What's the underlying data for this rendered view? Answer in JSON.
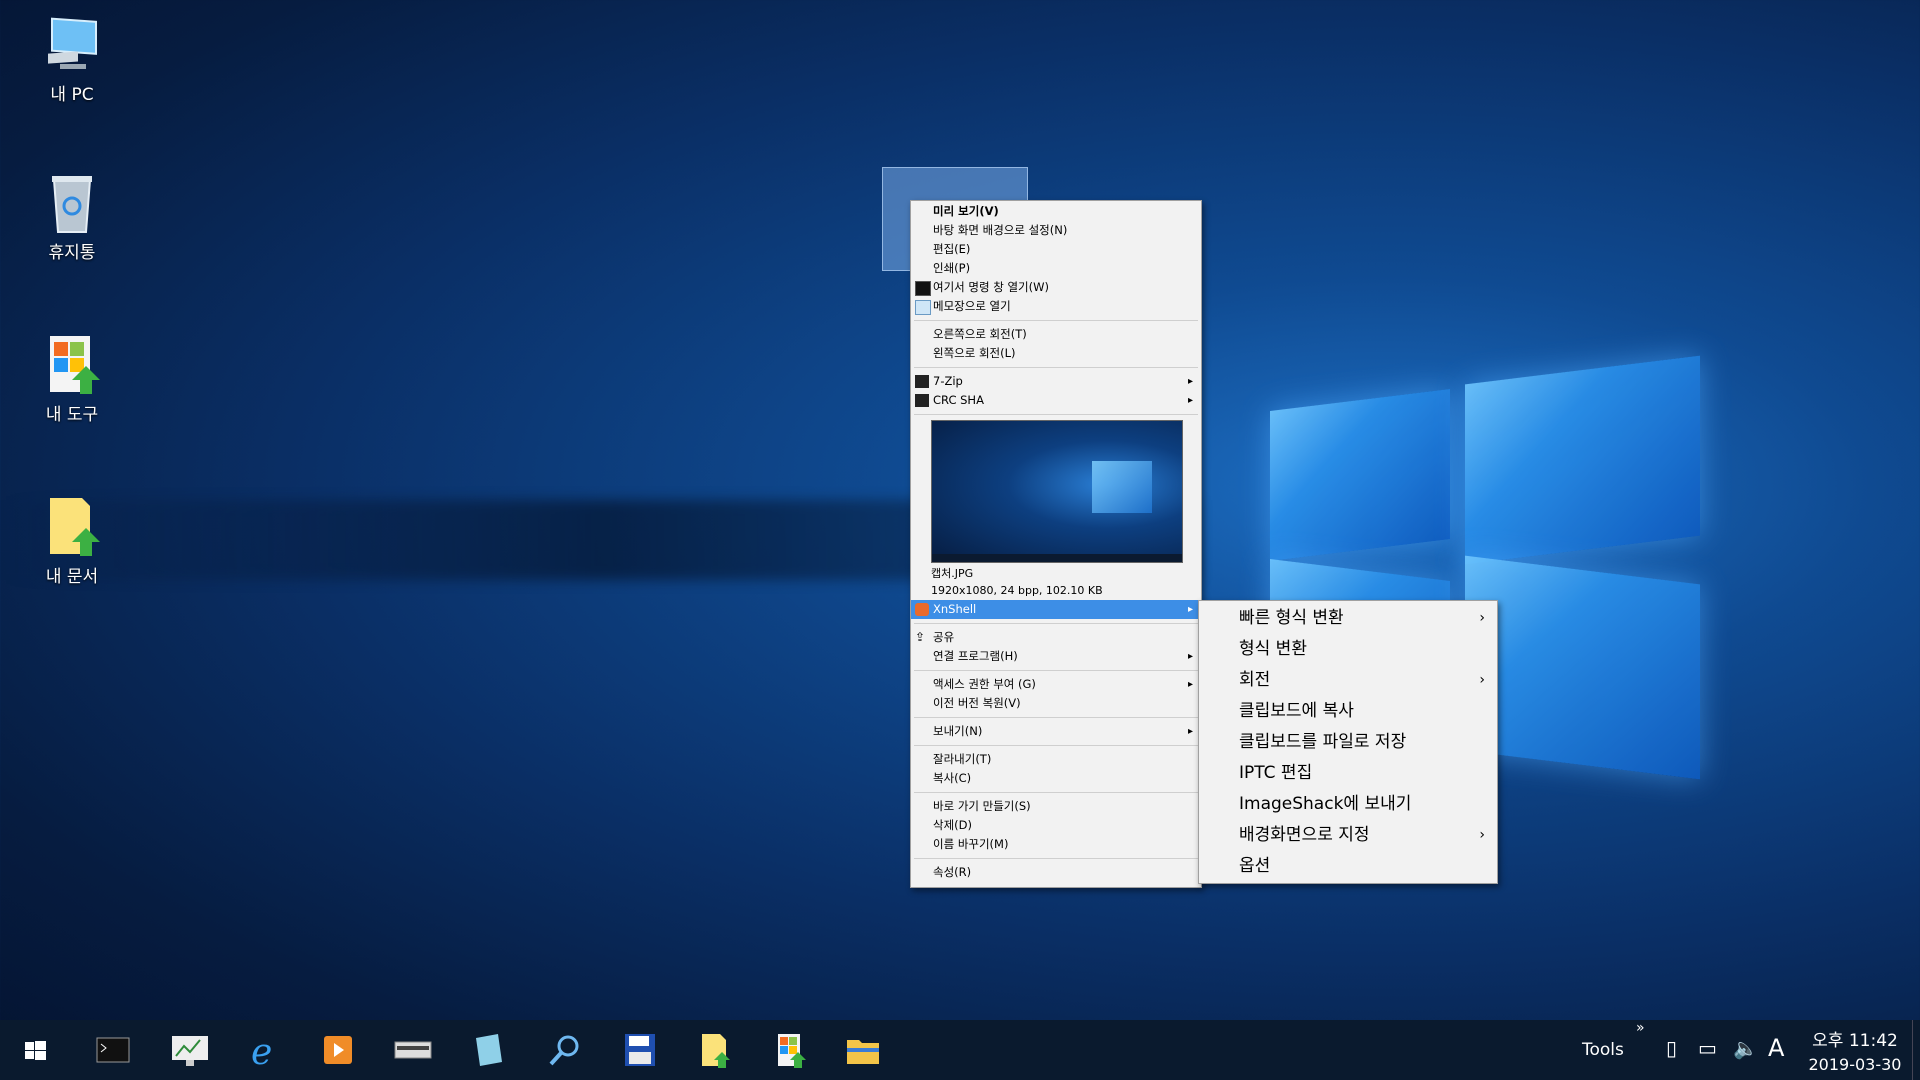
{
  "desktop": {
    "icons": [
      {
        "label": "내 PC",
        "icon": "pc-monitor-icon"
      },
      {
        "label": "휴지통",
        "icon": "recycle-bin-icon"
      },
      {
        "label": "내 도구",
        "icon": "tools-shortcut-icon"
      },
      {
        "label": "내 문서",
        "icon": "documents-shortcut-icon"
      }
    ]
  },
  "context_menu": {
    "items": [
      {
        "label": "미리 보기(V)"
      },
      {
        "label": "바탕 화면 배경으로 설정(N)"
      },
      {
        "label": "편집(E)"
      },
      {
        "label": "인쇄(P)"
      },
      {
        "label": "여기서 명령 창 열기(W)"
      },
      {
        "label": "메모장으로 열기"
      },
      {
        "label": "오른쪽으로 회전(T)"
      },
      {
        "label": "왼쪽으로 회전(L)"
      },
      {
        "label": "7-Zip"
      },
      {
        "label": "CRC SHA"
      },
      {
        "label": "XnShell"
      },
      {
        "label": "공유"
      },
      {
        "label": "연결 프로그램(H)"
      },
      {
        "label": "액세스 권한 부여 (G)"
      },
      {
        "label": "이전 버전 복원(V)"
      },
      {
        "label": "보내기(N)"
      },
      {
        "label": "잘라내기(T)"
      },
      {
        "label": "복사(C)"
      },
      {
        "label": "바로 가기 만들기(S)"
      },
      {
        "label": "삭제(D)"
      },
      {
        "label": "이름 바꾸기(M)"
      },
      {
        "label": "속성(R)"
      }
    ],
    "preview": {
      "filename": "캡처.JPG",
      "details": "1920x1080, 24 bpp, 102.10 KB"
    }
  },
  "xnshell_submenu": {
    "items": [
      {
        "label": "빠른 형식 변환"
      },
      {
        "label": "형식 변환"
      },
      {
        "label": "회전"
      },
      {
        "label": "클립보드에 복사"
      },
      {
        "label": "클립보드를 파일로 저장"
      },
      {
        "label": "IPTC 편집"
      },
      {
        "label": "ImageShack에 보내기"
      },
      {
        "label": "배경화면으로 지정"
      },
      {
        "label": "옵션"
      }
    ]
  },
  "taskbar": {
    "pinned": [
      "start-icon",
      "cmd-icon",
      "network-monitor-icon",
      "internet-explorer-icon",
      "media-player-icon",
      "scanner-icon",
      "notepad-book-icon",
      "search-tool-icon",
      "floppy-save-icon",
      "my-documents-icon",
      "my-tools-icon",
      "file-explorer-icon"
    ],
    "toolbar_label": "Tools",
    "toolbar_chevron": "»",
    "clock_time": "오후 11:42",
    "clock_date": "2019-03-30",
    "ime_indicator": "A"
  },
  "colors": {
    "menu_bg": "#f2f2f2",
    "highlight": "#3d8ee6",
    "taskbar": "#0a1a2e"
  }
}
